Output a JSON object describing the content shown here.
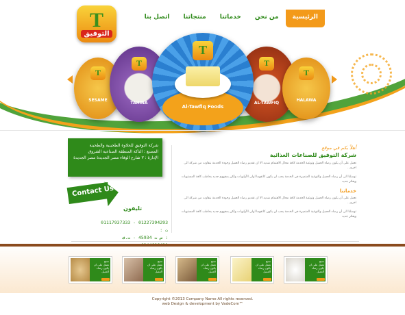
{
  "header": {
    "logo_letter": "T",
    "logo_name": "التوفيق",
    "nav": [
      {
        "label": "الرئيسية",
        "active": true
      },
      {
        "label": "من نحن",
        "active": false
      },
      {
        "label": "خدماتنا",
        "active": false
      },
      {
        "label": "منتجاتنا",
        "active": false
      },
      {
        "label": "اتصل بنا",
        "active": false
      }
    ]
  },
  "carousel": {
    "slides": [
      {
        "caption": "SESAME",
        "color": "#e8a21c"
      },
      {
        "caption": "TAHINA",
        "color": "#7a4aa0"
      },
      {
        "caption": "Al-Tawfiq Foods",
        "color": "#2e6cc4"
      },
      {
        "caption": "AL-TAWFIQ",
        "color": "#c23a1b"
      },
      {
        "caption": "HALAWA",
        "color": "#d89b1e"
      }
    ]
  },
  "info_box": {
    "lines": [
      "شركة التوفيق للحلاوة الطحينية والطحينة",
      "المصنع : الناكة المنطقة الصناعية الشروق",
      "الإدارة : ٣ شارع الوفاء مصر الجديدة مصر الجديدة"
    ]
  },
  "contact": {
    "button_label": "Contact Us",
    "phone_title": "تليفون",
    "phone_lines": [
      "01117937333 - 01227394293 : ت",
      "س ت 45934 - ت.ف :",
      "0244696421"
    ]
  },
  "about": {
    "kicker": "أهلاً بكم في موقع",
    "heading": "شركة التوفيق للصناعات الغذائية",
    "paragraphs": [
      "نعمل على أن يكون رضاء العميل وتوعية الخدمة كافة مجال الاهتمام شديد الا ان نقديم رضاء العميل وجودة الخدمة بتفاوت من شركة الى اخرى .",
      "توصلنا الى أن رضاء العميل والتوعية المتميزة في الخدمة يجب ان يكون كاتفهما اولى الأولويات ولكن بمفهوم جديد يخاطب كافة المستويات ويفكر جديد"
    ],
    "services_heading": "خدماتنا",
    "services_paragraphs": [
      "نعمل على أن يكون رضاء العميل وتوعية الخدمة كافة مجال الاهتمام شديد الا ان نقديم رضاء العميل وجودة الخدمة بتفاوت من شركة الى اخرى .",
      "توصلنا الى أن رضاء العميل والتوعية المتميزة في الخدمة يجب ان يكون كاتفهما اولى الأولويات ولكن بمفهوم جديد يخاطب كافة المستويات ويفكر جديد"
    ]
  },
  "products": [
    {
      "title": "منتج",
      "text": "نعمل على ان يكون رضاء العميل",
      "color": "#c79a55"
    },
    {
      "title": "منتج",
      "text": "نعمل على ان يكون رضاء العميل",
      "color": "#b58a6a"
    },
    {
      "title": "منتج",
      "text": "نعمل على ان يكون رضاء العميل",
      "color": "#9a7b4d"
    },
    {
      "title": "منتج",
      "text": "نعمل على ان يكون رضاء العميل",
      "color": "#f1e3a2"
    },
    {
      "title": "منتج",
      "text": "نعمل على ان يكون رضاء العميل",
      "color": "#e6e3dc"
    }
  ],
  "footer": {
    "copyright": "Copyright ©2013 Company Name  All rights reserved.",
    "credit": "web Design & development by VadeCom™"
  }
}
